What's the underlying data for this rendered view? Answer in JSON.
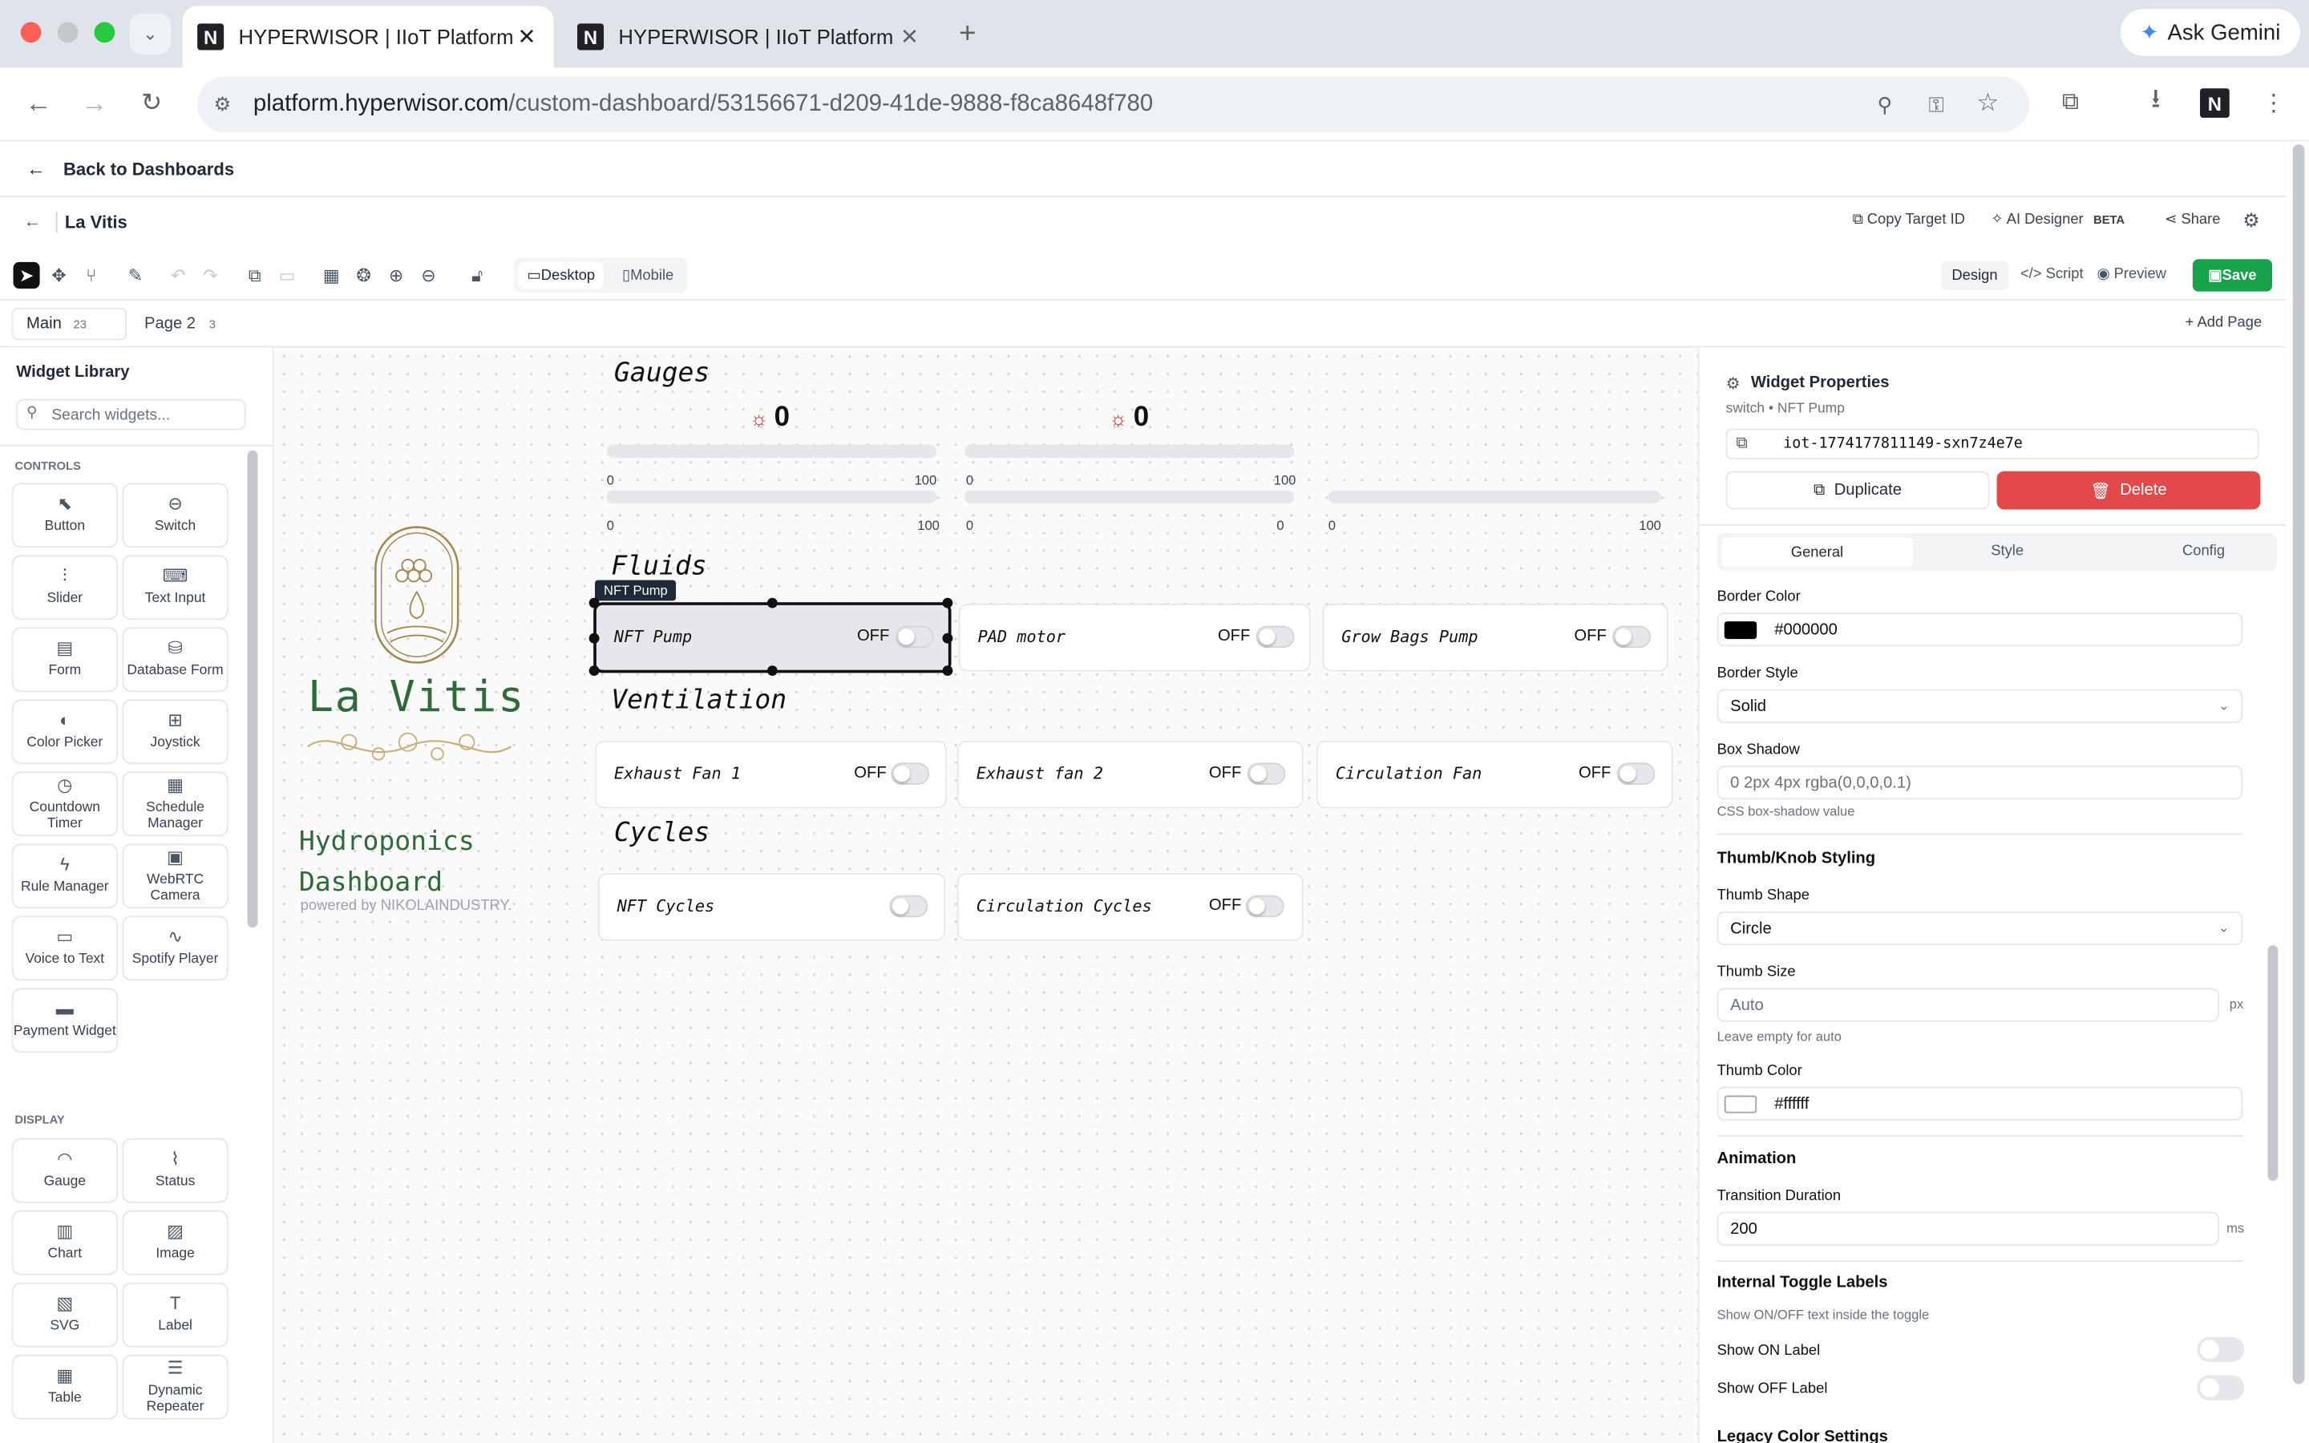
{
  "browser": {
    "tabs": [
      {
        "title": "HYPERWISOR | IIoT Platform"
      },
      {
        "title": "HYPERWISOR | IIoT Platform"
      }
    ],
    "ask_gemini": "Ask Gemini",
    "url_host": "platform.hyperwisor.com",
    "url_path": "/custom-dashboard/53156671-d209-41de-9888-f8ca8648f780"
  },
  "header": {
    "back_label": "Back to Dashboards",
    "dashboard_name": "La Vitis",
    "copy_target": "Copy Target ID",
    "ai_designer": "AI Designer",
    "beta": "BETA",
    "share": "Share"
  },
  "toolbar": {
    "desktop": "Desktop",
    "mobile": "Mobile",
    "design": "Design",
    "script": "Script",
    "preview": "Preview",
    "save": "Save"
  },
  "pages": {
    "main": {
      "label": "Main",
      "count": "23"
    },
    "page2": {
      "label": "Page 2",
      "count": "3"
    },
    "add": "Add Page"
  },
  "library": {
    "title": "Widget Library",
    "search_placeholder": "Search widgets...",
    "controls_heading": "CONTROLS",
    "display_heading": "DISPLAY",
    "controls": [
      {
        "label": "Button",
        "icon": "cursor-icon"
      },
      {
        "label": "Switch",
        "icon": "toggle-icon"
      },
      {
        "label": "Slider",
        "icon": "sliders-icon"
      },
      {
        "label": "Text Input",
        "icon": "keyboard-icon"
      },
      {
        "label": "Form",
        "icon": "file-icon"
      },
      {
        "label": "Database Form",
        "icon": "database-icon"
      },
      {
        "label": "Color Picker",
        "icon": "palette-icon"
      },
      {
        "label": "Joystick",
        "icon": "gamepad-icon"
      },
      {
        "label": "Countdown Timer",
        "icon": "clock-icon"
      },
      {
        "label": "Schedule Manager",
        "icon": "calendar-icon"
      },
      {
        "label": "Rule Manager",
        "icon": "bolt-icon"
      },
      {
        "label": "WebRTC Camera",
        "icon": "camera-icon"
      },
      {
        "label": "Voice to Text",
        "icon": "monitor-icon"
      },
      {
        "label": "Spotify Player",
        "icon": "wave-icon"
      },
      {
        "label": "Payment Widget",
        "icon": "card-icon"
      }
    ],
    "display": [
      {
        "label": "Gauge",
        "icon": "gauge-icon"
      },
      {
        "label": "Status",
        "icon": "pulse-icon"
      },
      {
        "label": "Chart",
        "icon": "chart-icon"
      },
      {
        "label": "Image",
        "icon": "image-icon"
      },
      {
        "label": "SVG",
        "icon": "svg-file-icon"
      },
      {
        "label": "Label",
        "icon": "text-icon"
      },
      {
        "label": "Table",
        "icon": "table-icon"
      },
      {
        "label": "Dynamic Repeater",
        "icon": "list-icon"
      }
    ]
  },
  "canvas": {
    "logo_title": "La Vitis",
    "dashboard_line1": "Hydroponics",
    "dashboard_line2": "Dashboard",
    "powered_by": "powered by NIKOLAINDUSTRY.",
    "sections": {
      "gauges": "Gauges",
      "fluids": "Fluids",
      "ventilation": "Ventilation",
      "cycles": "Cycles"
    },
    "gauge_values": [
      "0",
      "0"
    ],
    "gauge_min": "0",
    "gauge_max": "100",
    "selected_tag": "NFT Pump",
    "off": "OFF",
    "switches": {
      "nft_pump": "NFT Pump",
      "pad_motor": "PAD motor",
      "grow_bags": "Grow Bags Pump",
      "exhaust1": "Exhaust Fan 1",
      "exhaust2": "Exhaust fan 2",
      "circulation_fan": "Circulation Fan",
      "nft_cycles": "NFT Cycles",
      "circulation_cycles": "Circulation Cycles"
    }
  },
  "properties": {
    "title": "Widget Properties",
    "subtitle": "switch • NFT Pump",
    "widget_id": "iot-1774177811149-sxn7z4e7e",
    "duplicate": "Duplicate",
    "delete": "Delete",
    "tabs": {
      "general": "General",
      "style": "Style",
      "config": "Config"
    },
    "border_color_label": "Border Color",
    "border_color": "#000000",
    "border_style_label": "Border Style",
    "border_style": "Solid",
    "box_shadow_label": "Box Shadow",
    "box_shadow_placeholder": "0 2px 4px rgba(0,0,0,0.1)",
    "box_shadow_hint": "CSS box-shadow value",
    "thumb_heading": "Thumb/Knob Styling",
    "thumb_shape_label": "Thumb Shape",
    "thumb_shape": "Circle",
    "thumb_size_label": "Thumb Size",
    "thumb_size_placeholder": "Auto",
    "px": "px",
    "thumb_size_hint": "Leave empty for auto",
    "thumb_color_label": "Thumb Color",
    "thumb_color": "#ffffff",
    "animation_heading": "Animation",
    "transition_label": "Transition Duration",
    "transition_value": "200",
    "ms": "ms",
    "toggle_labels_heading": "Internal Toggle Labels",
    "toggle_labels_hint": "Show ON/OFF text inside the toggle",
    "show_on": "Show ON Label",
    "show_off": "Show OFF Label",
    "legacy": "Legacy Color Settings"
  },
  "colors": {
    "save_green": "#16a34a",
    "delete_red": "#e24a4a",
    "logo_green": "#2e6b3a"
  }
}
